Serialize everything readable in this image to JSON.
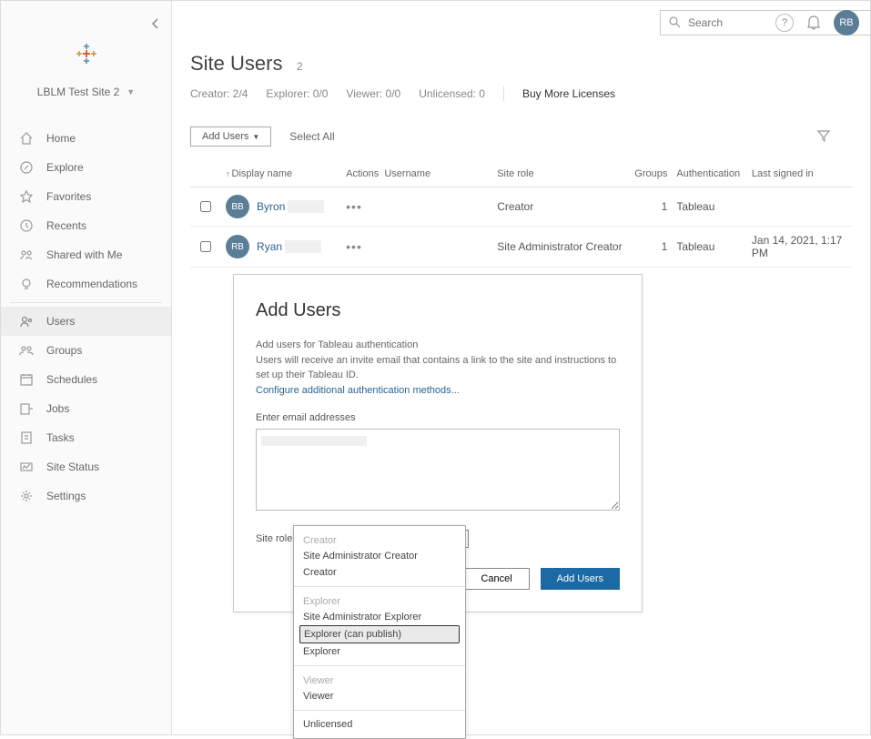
{
  "site_name": "LBLM Test Site 2",
  "search_placeholder": "Search",
  "user_initials": "RB",
  "nav": {
    "home": "Home",
    "explore": "Explore",
    "favorites": "Favorites",
    "recents": "Recents",
    "shared": "Shared with Me",
    "recs": "Recommendations",
    "users": "Users",
    "groups": "Groups",
    "schedules": "Schedules",
    "jobs": "Jobs",
    "tasks": "Tasks",
    "status": "Site Status",
    "settings": "Settings"
  },
  "page": {
    "title": "Site Users",
    "count": "2",
    "creator": "Creator: 2/4",
    "explorer": "Explorer: 0/0",
    "viewer": "Viewer: 0/0",
    "unlicensed": "Unlicensed: 0",
    "buy": "Buy More Licenses"
  },
  "toolbar": {
    "add_users": "Add Users",
    "select_all": "Select All"
  },
  "columns": {
    "display_name": "Display name",
    "actions": "Actions",
    "username": "Username",
    "site_role": "Site role",
    "groups": "Groups",
    "auth": "Authentication",
    "last": "Last signed in"
  },
  "rows": [
    {
      "initials": "BB",
      "name": "Byron",
      "role": "Creator",
      "groups": "1",
      "auth": "Tableau",
      "last": ""
    },
    {
      "initials": "RB",
      "name": "Ryan",
      "role": "Site Administrator Creator",
      "groups": "1",
      "auth": "Tableau",
      "last": "Jan 14, 2021, 1:17 PM"
    }
  ],
  "modal": {
    "title": "Add Users",
    "desc1": "Add users for Tableau authentication",
    "desc2": "Users will receive an invite email that contains a link to the site and instructions to set up their Tableau ID.",
    "config_link": "Configure additional authentication methods...",
    "enter_label": "Enter email addresses",
    "siterole_label": "Site role",
    "siterole_value": "Explorer (can publish)",
    "cancel": "Cancel",
    "add": "Add Users"
  },
  "dropdown": {
    "g1": "Creator",
    "i1": "Site Administrator Creator",
    "i2": "Creator",
    "g2": "Explorer",
    "i3": "Site Administrator Explorer",
    "i4": "Explorer (can publish)",
    "i5": "Explorer",
    "g3": "Viewer",
    "i6": "Viewer",
    "i7": "Unlicensed"
  }
}
